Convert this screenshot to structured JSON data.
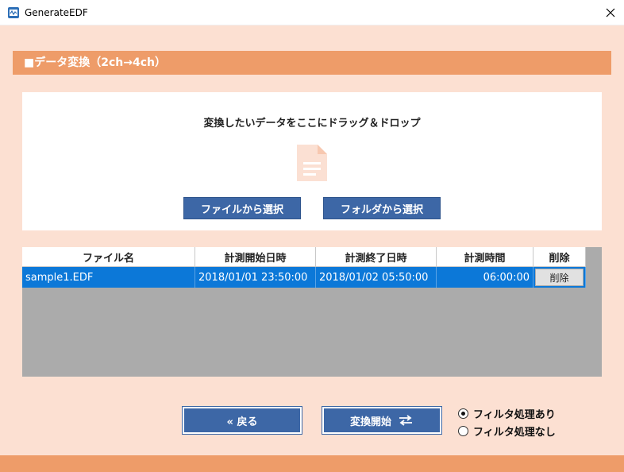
{
  "window": {
    "title": "GenerateEDF"
  },
  "header": {
    "title": "■データ変換（2ch→4ch）"
  },
  "drop_zone": {
    "instruction": "変換したいデータをここにドラッグ＆ドロップ",
    "select_file_label": "ファイルから選択",
    "select_folder_label": "フォルダから選択"
  },
  "table": {
    "columns": [
      "ファイル名",
      "計測開始日時",
      "計測終了日時",
      "計測時間",
      "削除"
    ],
    "rows": [
      {
        "file_name": "sample1.EDF",
        "start": "2018/01/01 23:50:00",
        "end": "2018/01/02 05:50:00",
        "duration": "06:00:00",
        "delete_label": "削除"
      }
    ]
  },
  "actions": {
    "back_label": "« 戻る",
    "convert_label": "変換開始"
  },
  "filter_options": {
    "selected": "with_filter",
    "with_filter_label": "フィルタ処理あり",
    "without_filter_label": "フィルタ処理なし"
  },
  "colors": {
    "accent": "#ee9c69",
    "background": "#fce0d2",
    "button": "#3d67a6",
    "selected_row": "#0c78d8"
  }
}
